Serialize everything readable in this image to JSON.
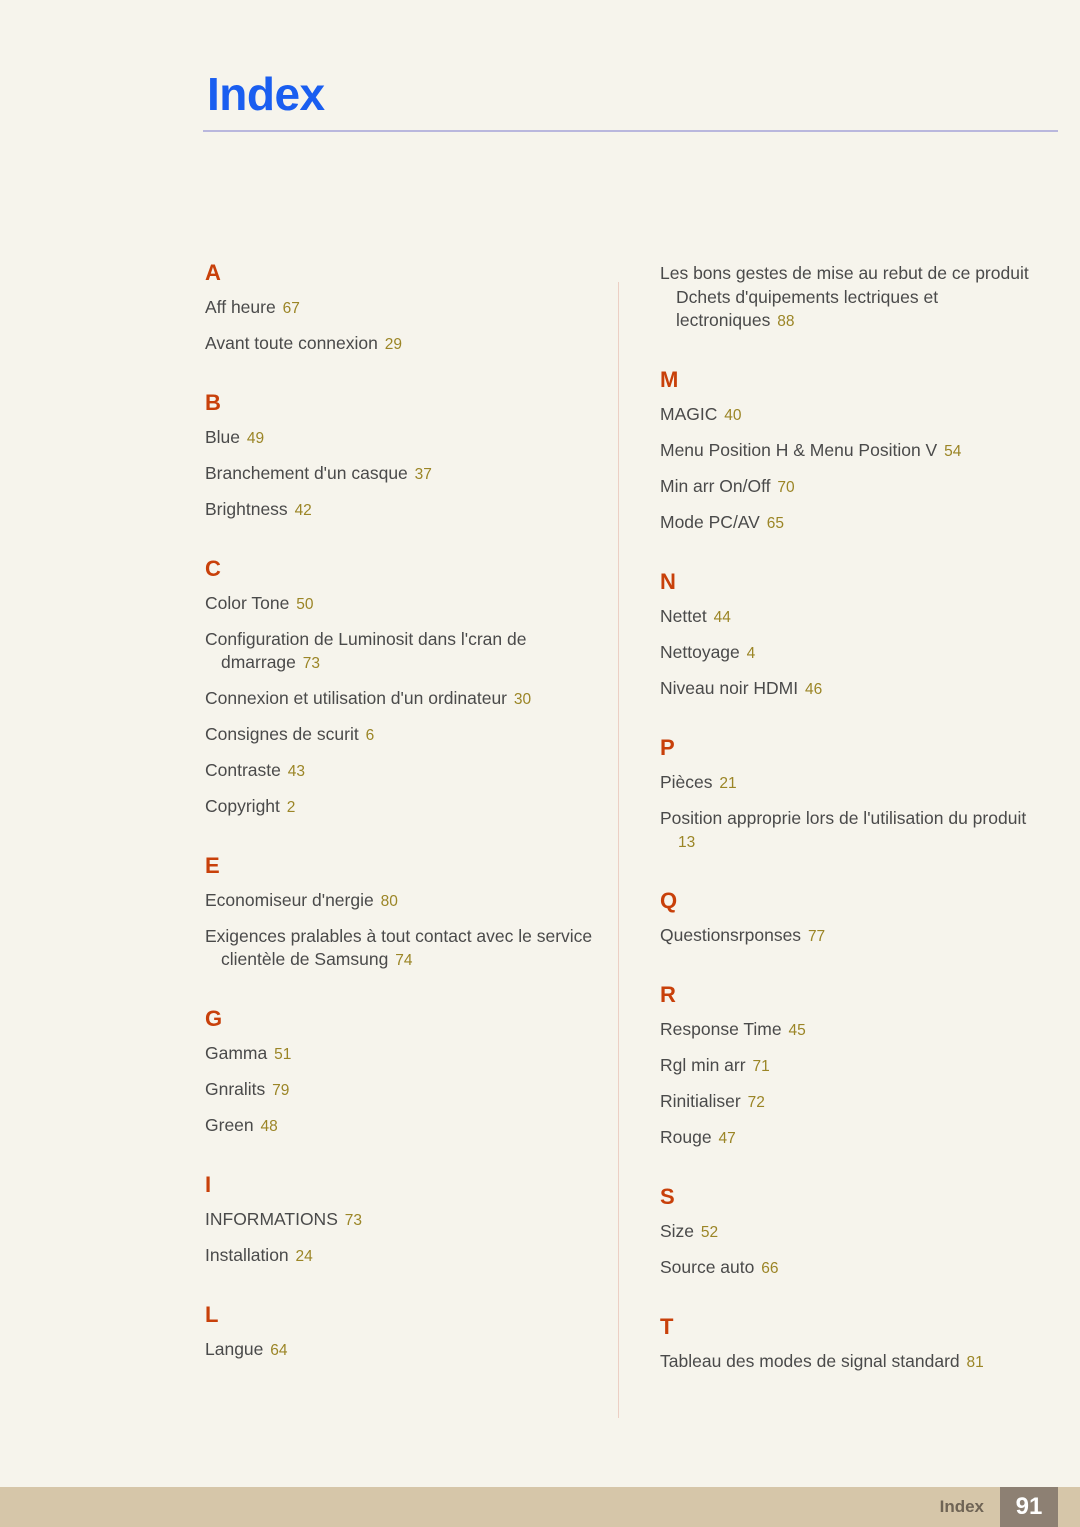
{
  "header": {
    "title": "Index"
  },
  "colors": {
    "background": "#f6f4ec",
    "title": "#1a5ef0",
    "header_rule": "#b9b7dd",
    "letter_heading": "#c8400a",
    "entry_text": "#4a4a4a",
    "page_ref": "#9b8526",
    "divider": "#eccfc4",
    "footer_band": "#d6c6a9",
    "footer_badge": "#8d8073",
    "footer_label": "#6f6455"
  },
  "columns": [
    {
      "name": "left-column",
      "continuation": null,
      "groups": [
        {
          "letter": "A",
          "entries": [
            {
              "text": "Aff heure",
              "page": "67",
              "wrapped": false
            },
            {
              "text": "Avant toute connexion",
              "page": "29",
              "wrapped": false
            }
          ]
        },
        {
          "letter": "B",
          "entries": [
            {
              "text": "Blue",
              "page": "49",
              "wrapped": false
            },
            {
              "text": "Branchement d'un casque",
              "page": "37",
              "wrapped": false
            },
            {
              "text": "Brightness",
              "page": "42",
              "wrapped": false
            }
          ]
        },
        {
          "letter": "C",
          "entries": [
            {
              "text": "Color Tone",
              "page": "50",
              "wrapped": false
            },
            {
              "text": "Configuration de Luminosit dans l'cran de dmarrage",
              "page": "73",
              "wrapped": true
            },
            {
              "text": "Connexion et utilisation d'un ordinateur",
              "page": "30",
              "wrapped": false
            },
            {
              "text": "Consignes de scurit",
              "page": "6",
              "wrapped": false
            },
            {
              "text": "Contraste",
              "page": "43",
              "wrapped": false
            },
            {
              "text": "Copyright",
              "page": "2",
              "wrapped": false
            }
          ]
        },
        {
          "letter": "E",
          "entries": [
            {
              "text": "Economiseur d'nergie",
              "page": "80",
              "wrapped": false
            },
            {
              "text": "Exigences pralables à tout contact avec le service clientèle de Samsung",
              "page": "74",
              "wrapped": true
            }
          ]
        },
        {
          "letter": "G",
          "entries": [
            {
              "text": "Gamma",
              "page": "51",
              "wrapped": false
            },
            {
              "text": "Gnralits",
              "page": "79",
              "wrapped": false
            },
            {
              "text": "Green",
              "page": "48",
              "wrapped": false
            }
          ]
        },
        {
          "letter": "I",
          "entries": [
            {
              "text": "INFORMATIONS",
              "page": "73",
              "wrapped": false
            },
            {
              "text": "Installation",
              "page": "24",
              "wrapped": false
            }
          ]
        },
        {
          "letter": "L",
          "entries": [
            {
              "text": "Langue",
              "page": "64",
              "wrapped": false
            }
          ]
        }
      ]
    },
    {
      "name": "right-column",
      "continuation": {
        "text": "Les bons gestes de mise au rebut de ce produit Dchets d'quipements lectriques et lectroniques",
        "page": "88",
        "wrapped": true
      },
      "groups": [
        {
          "letter": "M",
          "entries": [
            {
              "text": "MAGIC",
              "page": "40",
              "wrapped": false
            },
            {
              "text": "Menu Position H & Menu Position V",
              "page": "54",
              "wrapped": false
            },
            {
              "text": "Min arr On/Off",
              "page": "70",
              "wrapped": false
            },
            {
              "text": "Mode PC/AV",
              "page": "65",
              "wrapped": false
            }
          ]
        },
        {
          "letter": "N",
          "entries": [
            {
              "text": "Nettet",
              "page": "44",
              "wrapped": false
            },
            {
              "text": "Nettoyage",
              "page": "4",
              "wrapped": false
            },
            {
              "text": "Niveau noir HDMI",
              "page": "46",
              "wrapped": false
            }
          ]
        },
        {
          "letter": "P",
          "entries": [
            {
              "text": "Pièces",
              "page": "21",
              "wrapped": false
            },
            {
              "text": "Position approprie lors de l'utilisation du produit",
              "page": "13",
              "wrapped": true
            }
          ]
        },
        {
          "letter": "Q",
          "entries": [
            {
              "text": "Questionsrponses",
              "page": "77",
              "wrapped": false
            }
          ]
        },
        {
          "letter": "R",
          "entries": [
            {
              "text": "Response Time",
              "page": "45",
              "wrapped": false
            },
            {
              "text": "Rgl min arr",
              "page": "71",
              "wrapped": false
            },
            {
              "text": "Rinitialiser",
              "page": "72",
              "wrapped": false
            },
            {
              "text": "Rouge",
              "page": "47",
              "wrapped": false
            }
          ]
        },
        {
          "letter": "S",
          "entries": [
            {
              "text": "Size",
              "page": "52",
              "wrapped": false
            },
            {
              "text": "Source auto",
              "page": "66",
              "wrapped": false
            }
          ]
        },
        {
          "letter": "T",
          "entries": [
            {
              "text": "Tableau des modes de signal standard",
              "page": "81",
              "wrapped": false
            }
          ]
        }
      ]
    }
  ],
  "footer": {
    "label": "Index",
    "page_number": "91"
  }
}
